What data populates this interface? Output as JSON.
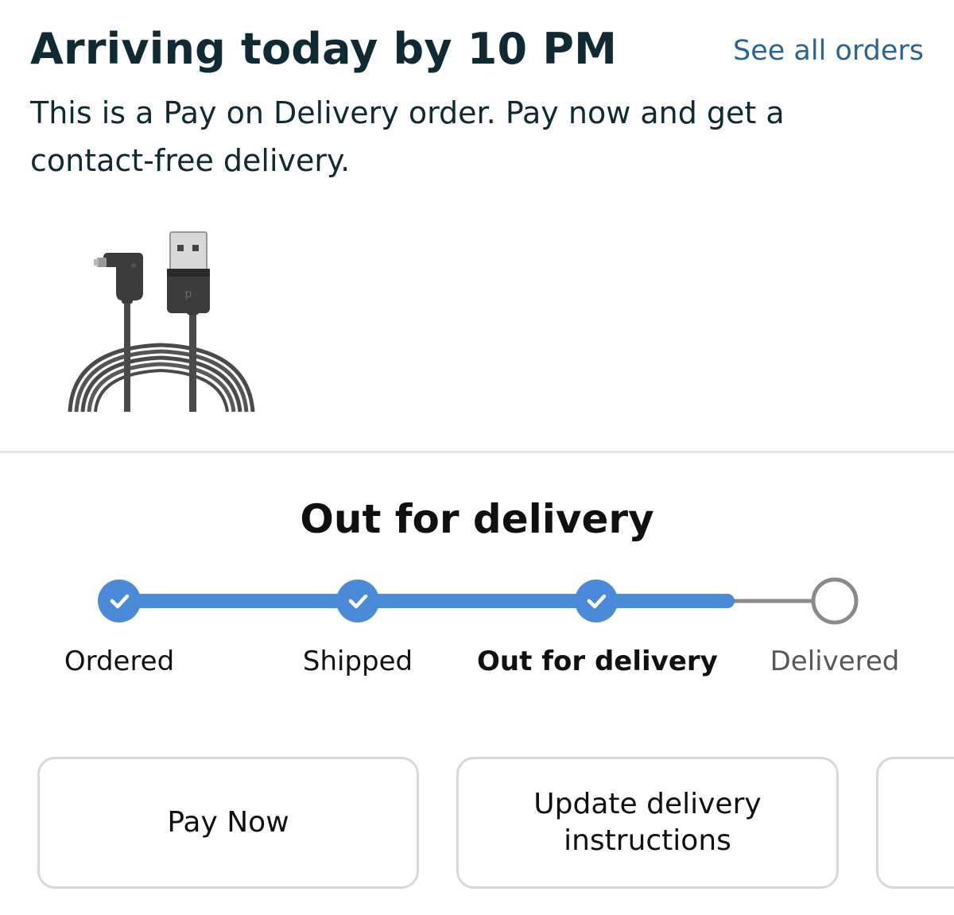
{
  "header": {
    "title": "Arriving today by 10 PM",
    "see_all_link": "See all orders",
    "subtitle": "This is a Pay on Delivery order. Pay now and get a contact-free delivery."
  },
  "product": {
    "image_icon": "usb-type-c-cable-image"
  },
  "tracking": {
    "status_heading": "Out for delivery",
    "progress_fraction": 0.85,
    "steps": [
      {
        "label": "Ordered",
        "state": "done"
      },
      {
        "label": "Shipped",
        "state": "done"
      },
      {
        "label": "Out for delivery",
        "state": "current"
      },
      {
        "label": "Delivered",
        "state": "pending"
      }
    ],
    "colors": {
      "active": "#4a8ad8",
      "inactive": "#8a8a8a"
    }
  },
  "actions": {
    "pay_now": "Pay Now",
    "update_instructions_line1": "Update delivery",
    "update_instructions_line2": "instructions"
  }
}
